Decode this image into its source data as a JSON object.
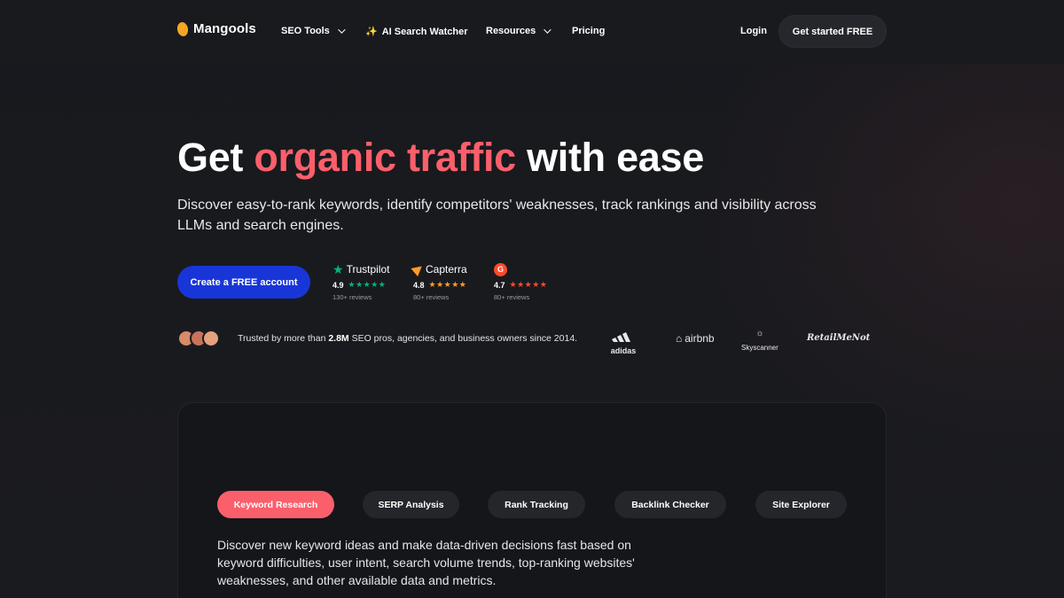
{
  "colors": {
    "accent": "#fb5f6b",
    "cta_blue": "#1836d8",
    "logo_yellow": "#f5a623",
    "trustpilot_green": "#00b67a",
    "capterra_orange": "#ff9d28",
    "g2_red": "#ff492c"
  },
  "nav": {
    "logo": "Mangools",
    "items": [
      {
        "label": "SEO Tools",
        "dropdown": true
      },
      {
        "label": "AI Search Watcher",
        "icon": "sparkles-icon"
      },
      {
        "label": "Resources",
        "dropdown": true
      },
      {
        "label": "Pricing"
      }
    ],
    "login": "Login",
    "get_started": "Get started FREE"
  },
  "hero": {
    "title_pre": "Get ",
    "title_accent": "organic traffic",
    "title_post": " with ease",
    "subtitle": "Discover easy-to-rank keywords, identify competitors' weaknesses, track rankings and visibility across LLMs and search engines.",
    "cta": "Create a FREE account"
  },
  "reviews": [
    {
      "brand": "Trustpilot",
      "rating": "4.9",
      "stars": "★★★★★",
      "count": "130+ reviews"
    },
    {
      "brand": "Capterra",
      "rating": "4.8",
      "stars": "★★★★★",
      "count": "80+ reviews"
    },
    {
      "brand": "G",
      "rating": "4.7",
      "stars": "★★★★★",
      "count": "80+ reviews"
    }
  ],
  "trust": {
    "pre": "Trusted by more than ",
    "highlight": "2.8M",
    "post": " SEO pros, agencies, and business owners since 2014."
  },
  "brands": [
    "adidas",
    "airbnb",
    "Skyscanner",
    "RetailMeNot"
  ],
  "features": {
    "tabs": [
      "Keyword Research",
      "SERP Analysis",
      "Rank Tracking",
      "Backlink Checker",
      "Site Explorer"
    ],
    "active_tab": "Keyword Research",
    "description": "Discover new keyword ideas and make data-driven decisions fast based on keyword difficulties, user intent, search volume trends, top-ranking websites' weaknesses, and other available data and metrics."
  }
}
